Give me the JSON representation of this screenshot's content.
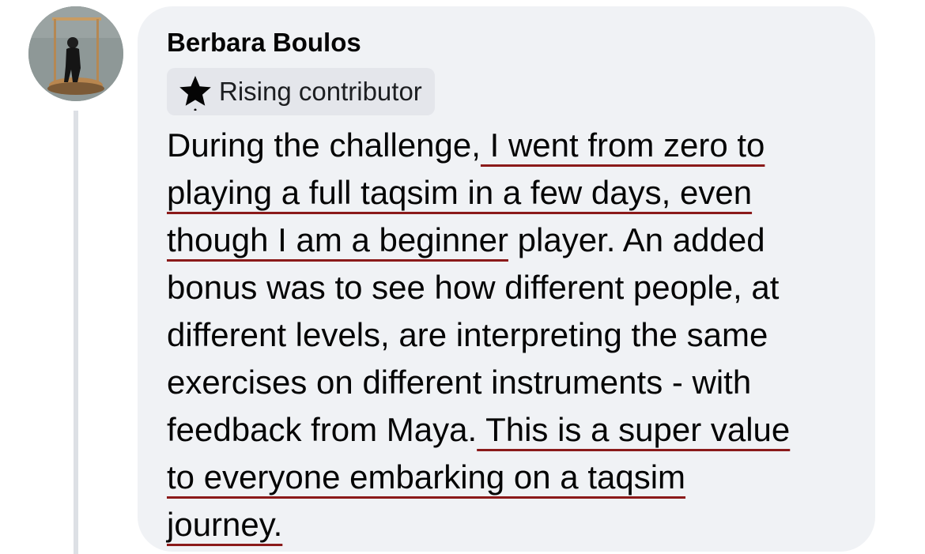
{
  "comment": {
    "author": "Berbara Boulos",
    "badge": {
      "icon": "star-icon",
      "label": "Rising contributor"
    },
    "lines": [
      [
        "During the challenge,",
        " I went from zero to"
      ],
      [
        "playing a full taqsim in a few days, even"
      ],
      [
        "though I am a beginner",
        " player. An added"
      ],
      [
        "bonus was to see how different people, at"
      ],
      [
        "different levels, are interpreting the same"
      ],
      [
        "exercises on different instruments - with"
      ],
      [
        "feedback from Maya.",
        " This is a super value"
      ],
      [
        "to everyone embarking on a taqsim"
      ],
      [
        "journey."
      ]
    ]
  },
  "colors": {
    "bubble_background": "#f0f2f5",
    "badge_background": "#e4e6eb",
    "underline": "#8b1a1a",
    "text": "#050505"
  }
}
